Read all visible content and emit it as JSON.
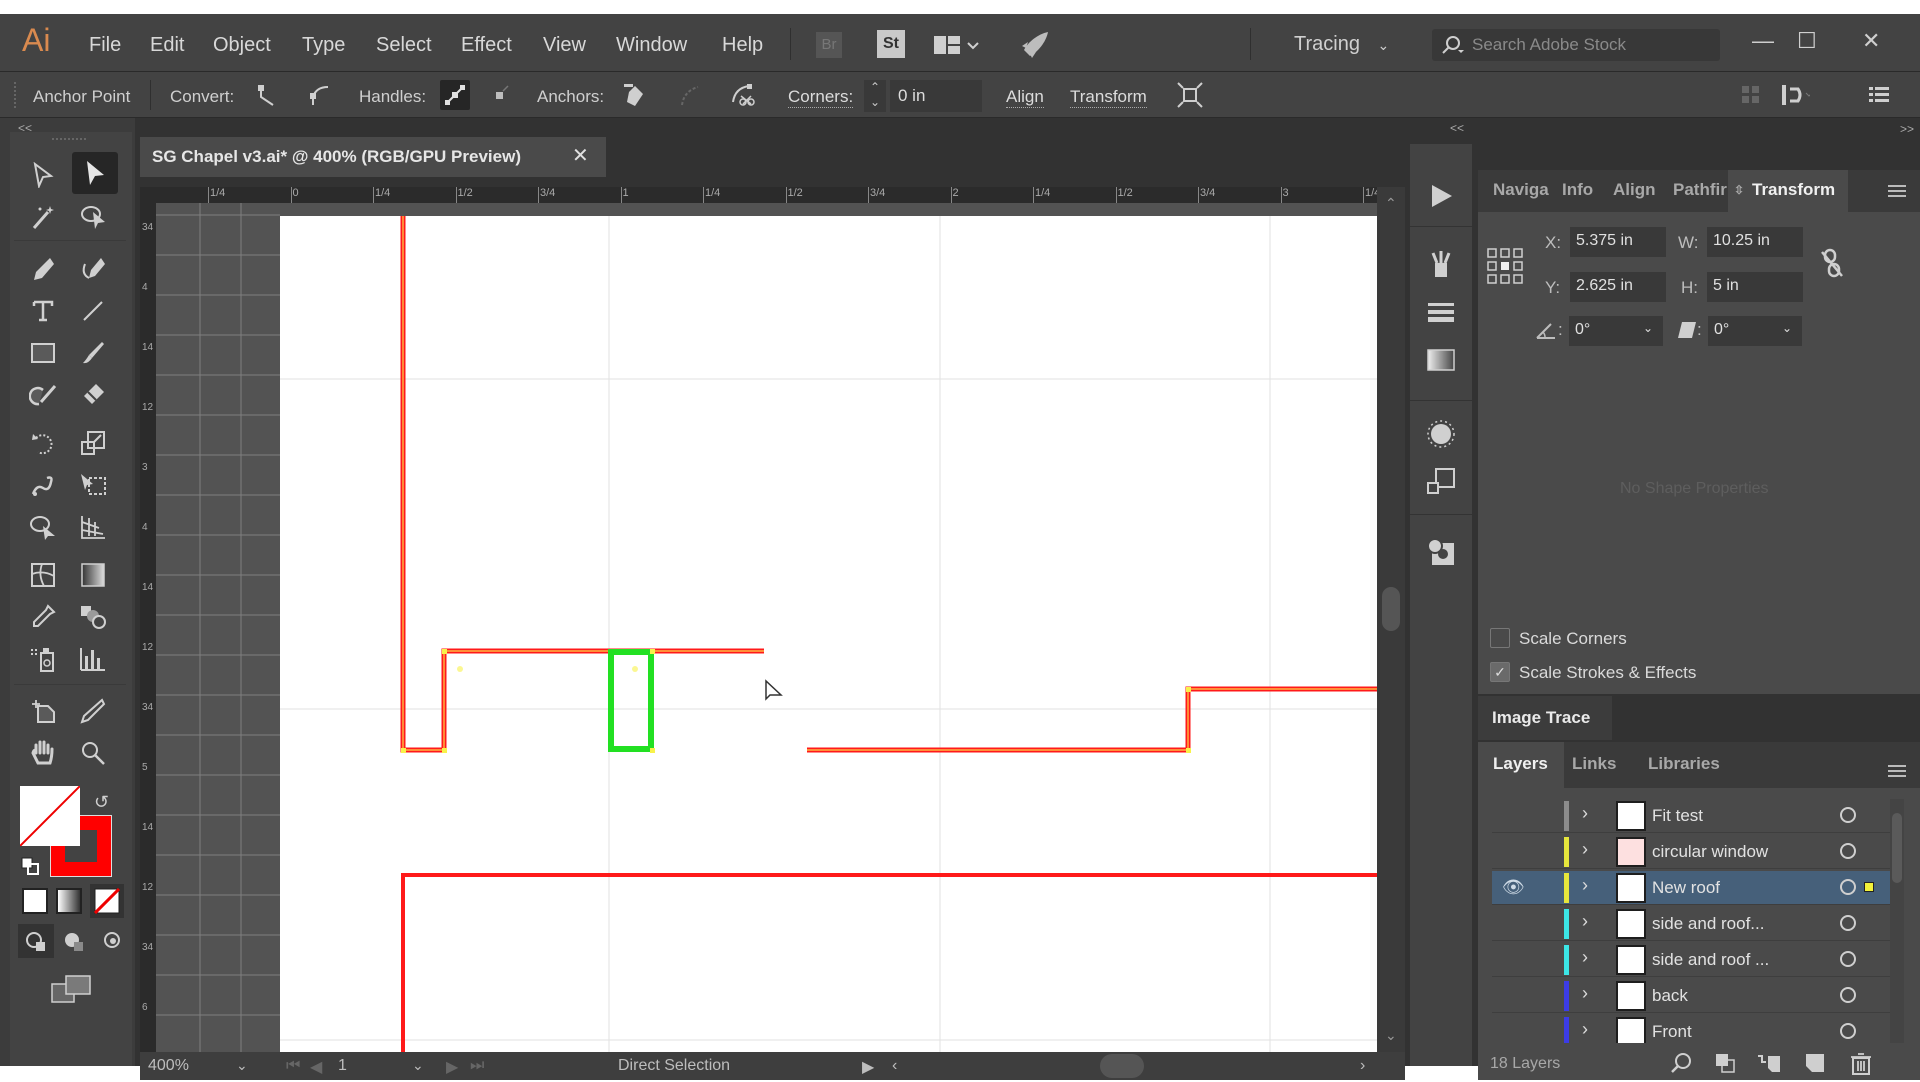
{
  "app": {
    "logo": "Ai",
    "menu": [
      "File",
      "Edit",
      "Object",
      "Type",
      "Select",
      "Effect",
      "View",
      "Window",
      "Help"
    ],
    "bridge_label": "Br",
    "stock_label": "St",
    "workspace": "Tracing",
    "search_placeholder": "Search Adobe Stock",
    "window_controls": {
      "minimize": "—",
      "maximize": "☐",
      "close": "✕"
    }
  },
  "options_bar": {
    "tool_name": "Anchor Point",
    "convert_label": "Convert:",
    "handles_label": "Handles:",
    "anchors_label": "Anchors:",
    "corners_label": "Corners:",
    "corners_value": "0 in",
    "align_label": "Align",
    "transform_label": "Transform"
  },
  "document": {
    "tab_title": "SG Chapel v3.ai* @ 400% (RGB/GPU Preview)",
    "close_glyph": "✕",
    "h_ruler_labels": [
      "1/4",
      "0",
      "1/4",
      "1/2",
      "3/4",
      "1",
      "1/4",
      "1/2",
      "3/4",
      "2",
      "1/4",
      "1/2",
      "3/4",
      "3",
      "1/4"
    ],
    "v_ruler_labels": [
      "3/4",
      "4",
      "1/4",
      "1/2",
      "3",
      "4",
      "1/4",
      "1/2",
      "3/4",
      "5",
      "1/4",
      "1/2",
      "3/4",
      "6"
    ]
  },
  "toolbar": {
    "collapse": "<<",
    "fill_color": "#ffffff",
    "stroke_color": "#ff0000"
  },
  "status_bar": {
    "zoom": "400%",
    "artboard": "1",
    "current_tool": "Direct Selection"
  },
  "transform_panel": {
    "tabs": [
      "Naviga",
      "Info",
      "Align",
      "Pathfir",
      "Transform"
    ],
    "active_tab": "Transform",
    "x_label": "X:",
    "x_value": "5.375 in",
    "y_label": "Y:",
    "y_value": "2.625 in",
    "w_label": "W:",
    "w_value": "10.25 in",
    "h_label": "H:",
    "h_value": "5 in",
    "rotate_value": "0°",
    "shear_value": "0°",
    "no_shape": "No Shape Properties",
    "scale_corners_label": "Scale Corners",
    "scale_corners_checked": false,
    "scale_strokes_label": "Scale Strokes & Effects",
    "scale_strokes_checked": true
  },
  "image_trace": {
    "label": "Image Trace"
  },
  "layers_panel": {
    "tabs": [
      "Layers",
      "Links",
      "Libraries"
    ],
    "active_tab": "Layers",
    "layers": [
      {
        "name": "Fit test",
        "color": "#8c8c8c",
        "visible": false,
        "selected": false
      },
      {
        "name": "circular window",
        "color": "#e6e63c",
        "visible": false,
        "selected": false
      },
      {
        "name": "New roof",
        "color": "#e6e63c",
        "visible": true,
        "selected": true
      },
      {
        "name": "side and roof...",
        "color": "#3ce6e6",
        "visible": false,
        "selected": false
      },
      {
        "name": "side and roof ...",
        "color": "#3ce6e6",
        "visible": false,
        "selected": false
      },
      {
        "name": "back",
        "color": "#3c3ce6",
        "visible": false,
        "selected": false
      },
      {
        "name": "Front",
        "color": "#3c3ce6",
        "visible": false,
        "selected": false
      }
    ],
    "count_label": "18 Layers"
  }
}
